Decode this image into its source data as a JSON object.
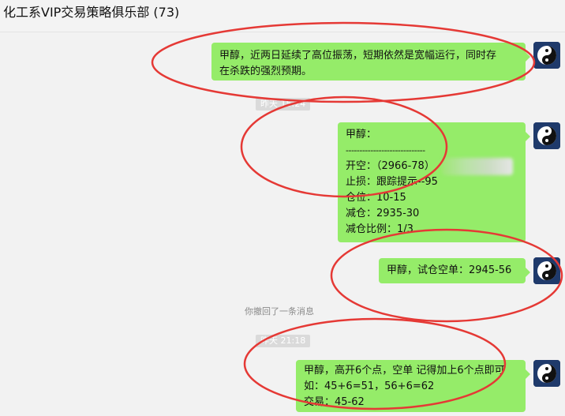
{
  "header": {
    "title": "化工系VIP交易策略俱乐部 (73)"
  },
  "messages": [
    {
      "lines": [
        "甲醇，近两日延续了高位振荡，短期依然是宽幅运行，同时存",
        "在杀跌的强烈预期。"
      ]
    },
    {
      "lines": [
        "甲醇：",
        "-----------------------------",
        "开空：（2966-78）",
        "止损：跟踪提示--95",
        "仓位：10-15",
        "减仓：2935-30",
        "减仓比例：1/3"
      ]
    },
    {
      "lines": [
        "甲醇，试仓空单：2945-56"
      ]
    },
    {
      "lines": [
        "甲醇，高开6个点，空单 记得加上6个点即可",
        "如：45+6=51，56+6=62",
        "交易：45-62"
      ]
    }
  ],
  "timestamps": {
    "t1": "昨天 15:24",
    "t2": "昨天 21:18"
  },
  "notice": "你撤回了一条消息",
  "icons": {
    "avatar": "yin-yang-icon"
  },
  "colors": {
    "bubble": "#95ec69",
    "annotation": "#e53935",
    "avatar_bg": "#1f3a6b"
  }
}
